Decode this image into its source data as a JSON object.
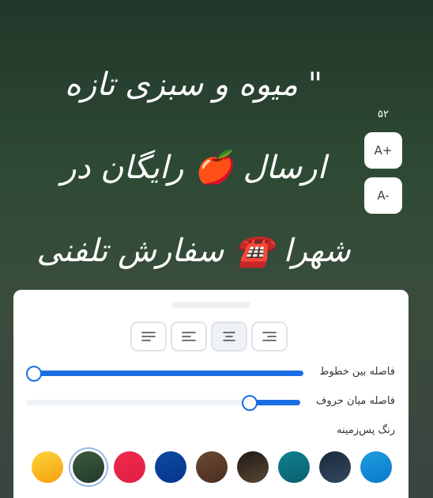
{
  "post": {
    "text": "\" میوه و سبزی تازه ارسال 🍎 رایگان در شهرا ☎️ سفارش تلفنی \""
  },
  "font_controls": {
    "size_value": "۵۲",
    "increase_label": "A+",
    "decrease_label": "A-"
  },
  "panel": {
    "alignment_options": [
      "align-left",
      "align-center-left",
      "align-center",
      "align-right"
    ],
    "selected_alignment": "align-center",
    "line_spacing_label": "فاصله بین خطوط",
    "line_spacing_value": 0.0,
    "letter_spacing_label": "فاصله میان حروف",
    "letter_spacing_value": 0.81,
    "background_color_label": "رنگ پس‌زمینه",
    "background_colors": [
      {
        "name": "yellow",
        "from": "#ffd43b",
        "to": "#f59f0b"
      },
      {
        "name": "dark-green",
        "from": "#3f5a3f",
        "to": "#1f3b29"
      },
      {
        "name": "red",
        "from": "#ee2a4a",
        "to": "#e01e46"
      },
      {
        "name": "navy",
        "from": "#0e4aa1",
        "to": "#06358c"
      },
      {
        "name": "brown",
        "from": "#6b4a33",
        "to": "#4a2e1e"
      },
      {
        "name": "dark-brown",
        "from": "#1e1a16",
        "to": "#5a4634"
      },
      {
        "name": "teal",
        "from": "#0f8192",
        "to": "#0a5f6e"
      },
      {
        "name": "dark-slate",
        "from": "#1a2a3c",
        "to": "#33475e"
      },
      {
        "name": "sky-blue",
        "from": "#1f9de0",
        "to": "#0a7ac8"
      }
    ],
    "selected_background": "dark-green",
    "accent_color": "#1a6ee3"
  }
}
